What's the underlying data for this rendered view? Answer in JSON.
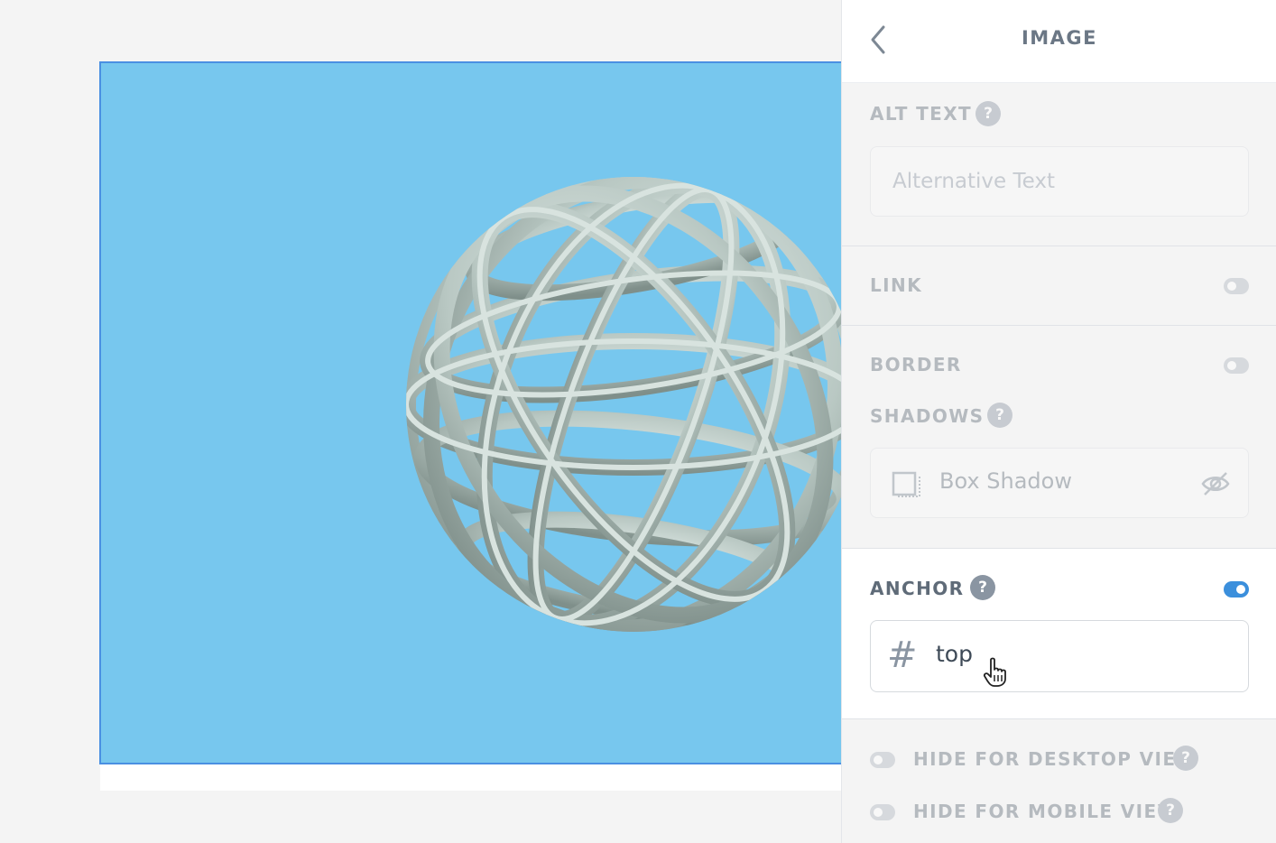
{
  "panel": {
    "title": "IMAGE",
    "alt_text": {
      "label": "ALT TEXT",
      "placeholder": "Alternative Text",
      "help": "?"
    },
    "link": {
      "label": "LINK",
      "enabled": false
    },
    "border": {
      "label": "BORDER",
      "enabled": false
    },
    "shadows": {
      "label": "SHADOWS",
      "help": "?",
      "item_label": "Box Shadow"
    },
    "anchor": {
      "label": "ANCHOR",
      "help": "?",
      "enabled": true,
      "prefix": "#",
      "value": "top"
    },
    "visibility": {
      "desktop_label": "HIDE FOR DESKTOP VIEW",
      "mobile_label": "HIDE FOR MOBILE VIEW",
      "help": "?"
    }
  },
  "colors": {
    "image_background": "#77c7ee",
    "selection_outline": "#4a90e2",
    "toggle_on": "#3b8fdc",
    "toggle_off": "#aeb6bf"
  },
  "icons": [
    "chevron-left-icon",
    "help-icon",
    "box-shadow-icon",
    "eye-slash-icon",
    "hand-pointer-icon"
  ]
}
